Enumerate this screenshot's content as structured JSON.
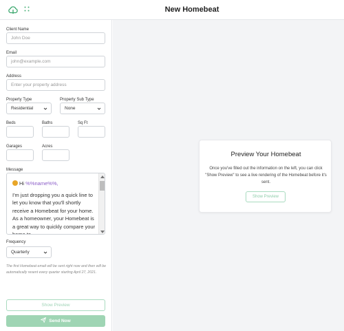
{
  "header": {
    "title": "New Homebeat"
  },
  "form": {
    "client_name": {
      "label": "Client Name",
      "placeholder": "John Doe"
    },
    "email": {
      "label": "Email",
      "placeholder": "john@example.com"
    },
    "address": {
      "label": "Address",
      "placeholder": "Enter your property address"
    },
    "property_type": {
      "label": "Property Type",
      "value": "Residential"
    },
    "property_sub_type": {
      "label": "Property Sub Type",
      "value": "None"
    },
    "beds": {
      "label": "Beds",
      "value": ""
    },
    "baths": {
      "label": "Baths",
      "value": ""
    },
    "sq_ft": {
      "label": "Sq Ft",
      "value": ""
    },
    "garages": {
      "label": "Garages",
      "value": ""
    },
    "acres": {
      "label": "Acres",
      "value": ""
    },
    "message": {
      "label": "Message",
      "greeting": "Hi ",
      "token": "%%name%%,",
      "body": "I'm just dropping you a quick line to let you know that you'll shortly receive a Homebeat for your home. As a homeowner, your Homebeat is a great way to quickly compare your home to"
    },
    "frequency": {
      "label": "Frequency",
      "value": "Quarterly"
    },
    "note": "The first Homebeat email will be sent right now and then will be automatically resent every quarter starting April 27, 2021."
  },
  "buttons": {
    "show_preview": "Show Preview",
    "send_now": "Send Now"
  },
  "preview": {
    "title": "Preview Your Homebeat",
    "description": "Once you've filled out the information on the left, you can click \"Show Preview\" to see a live rendering of the Homebeat before it's sent.",
    "button": "Show Preview"
  },
  "icons": {
    "logo": "cloud-logo-icon",
    "apps": "grid-icon",
    "send": "paper-plane-icon",
    "chevron": "chevron-down-icon"
  },
  "colors": {
    "accent": "#4bb07a",
    "accent_light": "#9fd5b4",
    "token": "#8a5cc7"
  }
}
